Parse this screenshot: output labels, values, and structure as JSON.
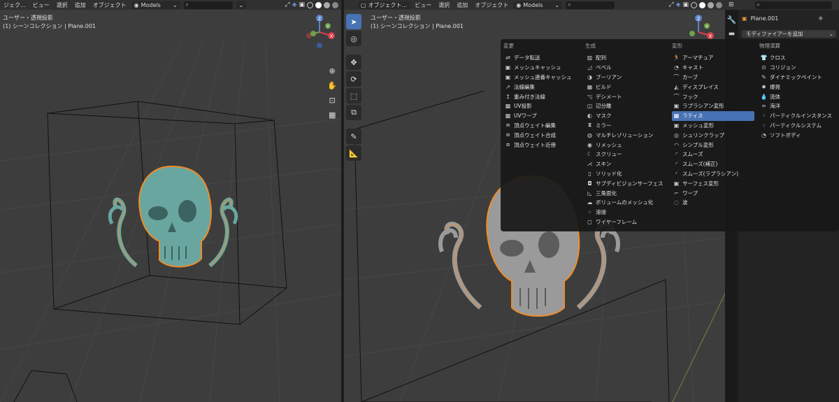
{
  "header": {
    "editor_label": "ジェク...",
    "menu": [
      "ビュー",
      "選択",
      "追加",
      "オブジェクト"
    ],
    "collection_dropdown": "Models",
    "search_icon": "search-icon"
  },
  "right_header": {
    "mode_dropdown": "オブジェクト...",
    "menu": [
      "ビュー",
      "選択",
      "追加",
      "オブジェクト"
    ],
    "collection_dropdown": "Models"
  },
  "viewport_left": {
    "view_name": "ユーザー・透視投影",
    "collection_info": "(1) シーンコレクション | Plane.001"
  },
  "viewport_right": {
    "view_name": "ユーザー・透視投影",
    "collection_info": "(1) シーンコレクション | Plane.001"
  },
  "gizmo": {
    "z": "Z",
    "y": "Y",
    "x": "X"
  },
  "modifier_menu": {
    "columns": [
      {
        "heading": "変更",
        "items": [
          "データ転送",
          "メッシュキャッシュ",
          "メッシュ連番キャッシュ",
          "法線編集",
          "重み付き法線",
          "UV投影",
          "UVワープ",
          "頂点ウェイト編集",
          "頂点ウェイト合成",
          "頂点ウェイト近傍"
        ]
      },
      {
        "heading": "生成",
        "items": [
          "配列",
          "ベベル",
          "ブーリアン",
          "ビルド",
          "デシメート",
          "辺分離",
          "マスク",
          "ミラー",
          "マルチレゾリューション",
          "リメッシュ",
          "スクリュー",
          "スキン",
          "ソリッド化",
          "サブディビジョンサーフェス",
          "三角面化",
          "ボリュームのメッシュ化",
          "溶接",
          "ワイヤーフレーム"
        ]
      },
      {
        "heading": "変形",
        "items": [
          "アーマチュア",
          "キャスト",
          "カーブ",
          "ディスプレイス",
          "フック",
          "ラプラシアン変形",
          "ラティス",
          "メッシュ変形",
          "シュリンクラップ",
          "シンプル変形",
          "スムーズ",
          "スムーズ(補正)",
          "スムーズ(ラプラシアン)",
          "サーフェス変形",
          "ワープ",
          "波"
        ]
      },
      {
        "heading": "物理演算",
        "items": [
          "クロス",
          "コリジョン",
          "ダイナミックペイント",
          "爆発",
          "流体",
          "海洋",
          "パーティクルインスタンス",
          "パーティクルシステム",
          "ソフトボディ"
        ]
      }
    ],
    "highlighted": "ラティス"
  },
  "properties": {
    "object_name": "Plane.001",
    "add_modifier": "モディファイアーを追加"
  },
  "colors": {
    "viewport_bg": "#3d3d3d",
    "highlight": "#4772b3",
    "selection_outline": "#f08c28",
    "skull_left": "#6aa6a0",
    "skull_right": "#9a9a9a"
  }
}
